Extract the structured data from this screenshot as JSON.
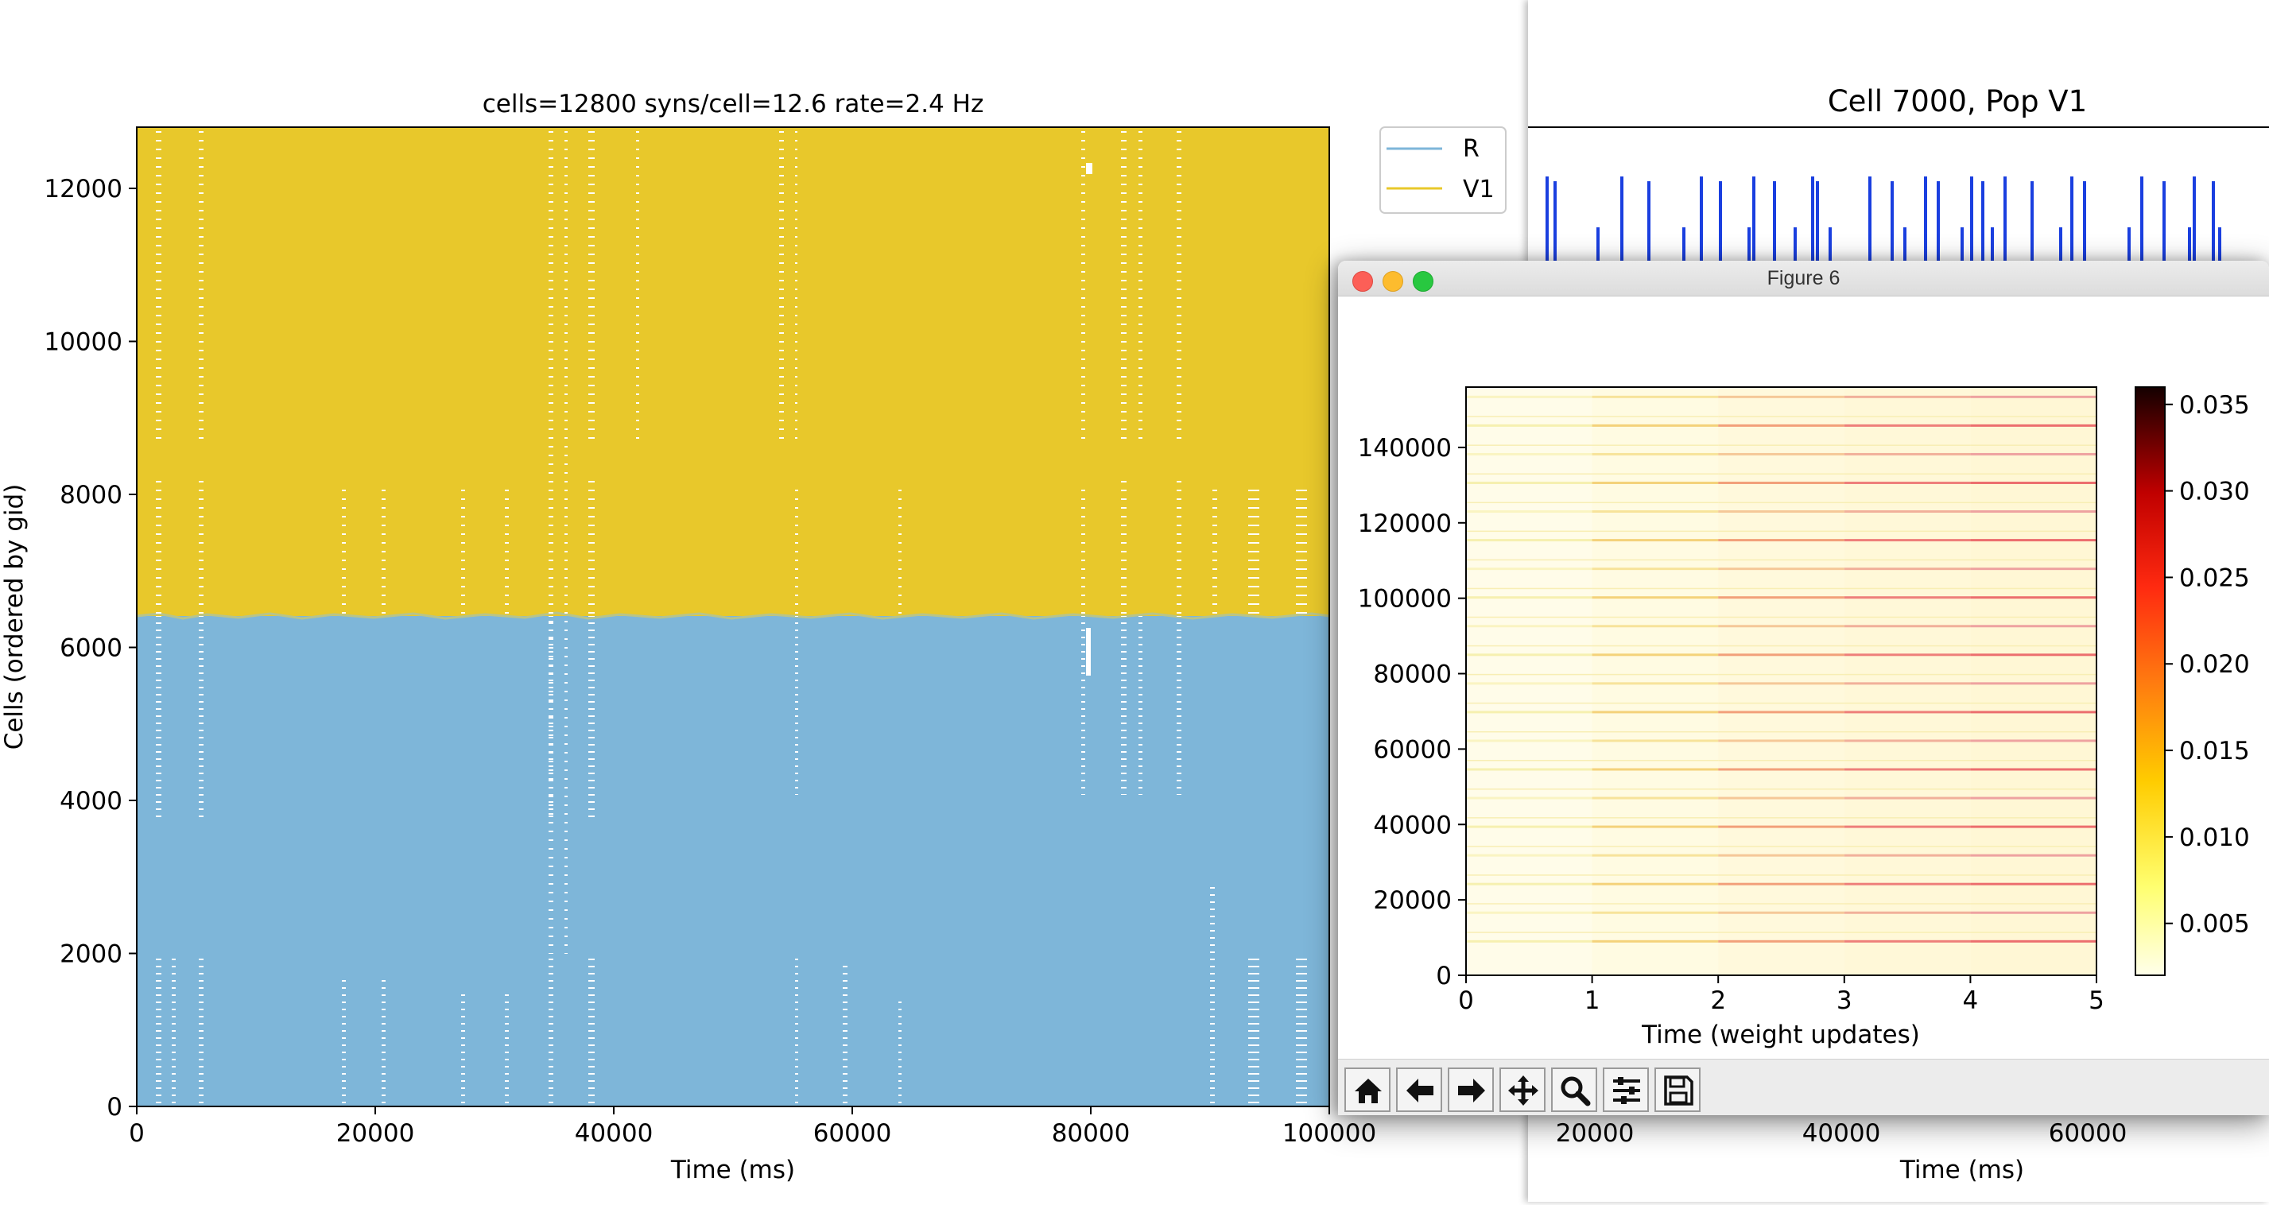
{
  "raster": {
    "title": "cells=12800   syns/cell=12.6   rate=2.4 Hz",
    "xlabel": "Time (ms)",
    "ylabel": "Cells (ordered by gid)",
    "xticks": [
      "0",
      "20000",
      "40000",
      "60000",
      "80000",
      "100000"
    ],
    "yticks": [
      "0",
      "2000",
      "4000",
      "6000",
      "8000",
      "10000",
      "12000"
    ],
    "legend": [
      "R",
      "V1"
    ]
  },
  "cell_plot": {
    "title": "Cell 7000, Pop V1",
    "xlabel": "Time (ms)",
    "xticks": [
      "20000",
      "40000",
      "60000"
    ]
  },
  "figure6": {
    "window_title": "Figure 6",
    "xlabel": "Time (weight updates)",
    "xticks": [
      "0",
      "1",
      "2",
      "3",
      "4",
      "5"
    ],
    "yticks": [
      "0",
      "20000",
      "40000",
      "60000",
      "80000",
      "100000",
      "120000",
      "140000"
    ],
    "colorbar_ticks": [
      "0.005",
      "0.010",
      "0.015",
      "0.020",
      "0.025",
      "0.030",
      "0.035"
    ],
    "toolbar": [
      "home-icon",
      "back-arrow-icon",
      "forward-arrow-icon",
      "pan-icon",
      "zoom-icon",
      "configure-subplots-icon",
      "save-icon"
    ]
  },
  "colors": {
    "pop_R": "#7eb6d9",
    "pop_V1": "#e8c82b",
    "spike_trace": "#1a3fe0"
  },
  "chart_data": [
    {
      "type": "scatter",
      "title": "cells=12800   syns/cell=12.6   rate=2.4 Hz",
      "xlabel": "Time (ms)",
      "ylabel": "Cells (ordered by gid)",
      "xlim": [
        0,
        100000
      ],
      "ylim": [
        0,
        12800
      ],
      "legend_placement": "outside-top-right",
      "series": [
        {
          "name": "R",
          "gid_range": [
            0,
            6400
          ],
          "color": "#7eb6d9"
        },
        {
          "name": "V1",
          "gid_range": [
            6400,
            12800
          ],
          "color": "#e8c82b"
        }
      ]
    },
    {
      "type": "line",
      "title": "Cell 7000, Pop V1",
      "xlabel": "Time (ms)"
    },
    {
      "type": "heatmap",
      "xlabel": "Time (weight updates)",
      "xlim": [
        0,
        5
      ],
      "ylim": [
        0,
        156000
      ],
      "colorbar_range": [
        0.002,
        0.036
      ]
    }
  ]
}
